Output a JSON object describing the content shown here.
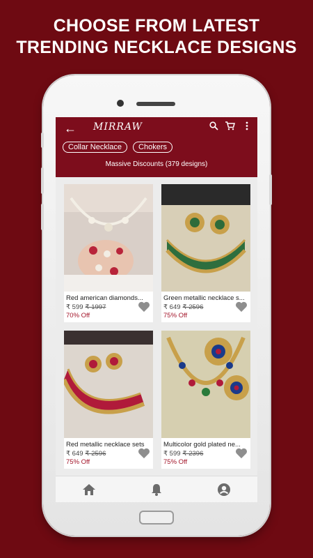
{
  "headline": {
    "line1": "CHOOSE FROM LATEST",
    "line2": "TRENDING NECKLACE DESIGNS"
  },
  "appbar": {
    "back_icon": "arrow-left-icon",
    "logo": "MIRRAW",
    "tools": [
      "search-icon",
      "cart-icon",
      "more-vert-icon"
    ]
  },
  "chips": [
    "Collar Necklace",
    "Chokers"
  ],
  "discount_text": "Massive Discounts (379 designs)",
  "products": [
    {
      "name": "Red american  diamonds...",
      "price": "₹ 599",
      "original": "₹ 1997",
      "off": "70% Off"
    },
    {
      "name": "Green metallic necklace  s...",
      "price": "₹ 649",
      "original": "₹ 2596",
      "off": "75% Off"
    },
    {
      "name": "Red metallic necklace  sets",
      "price": "₹ 649",
      "original": "₹ 2596",
      "off": "75% Off"
    },
    {
      "name": "Multicolor gold  plated ne...",
      "price": "₹ 599",
      "original": "₹ 2396",
      "off": "75% Off"
    }
  ],
  "bottom_nav": [
    "home-icon",
    "bell-icon",
    "account-icon"
  ],
  "colors": {
    "background": "#6e0a12",
    "appbar": "#7d0d1c",
    "discount_red": "#a3152a"
  }
}
